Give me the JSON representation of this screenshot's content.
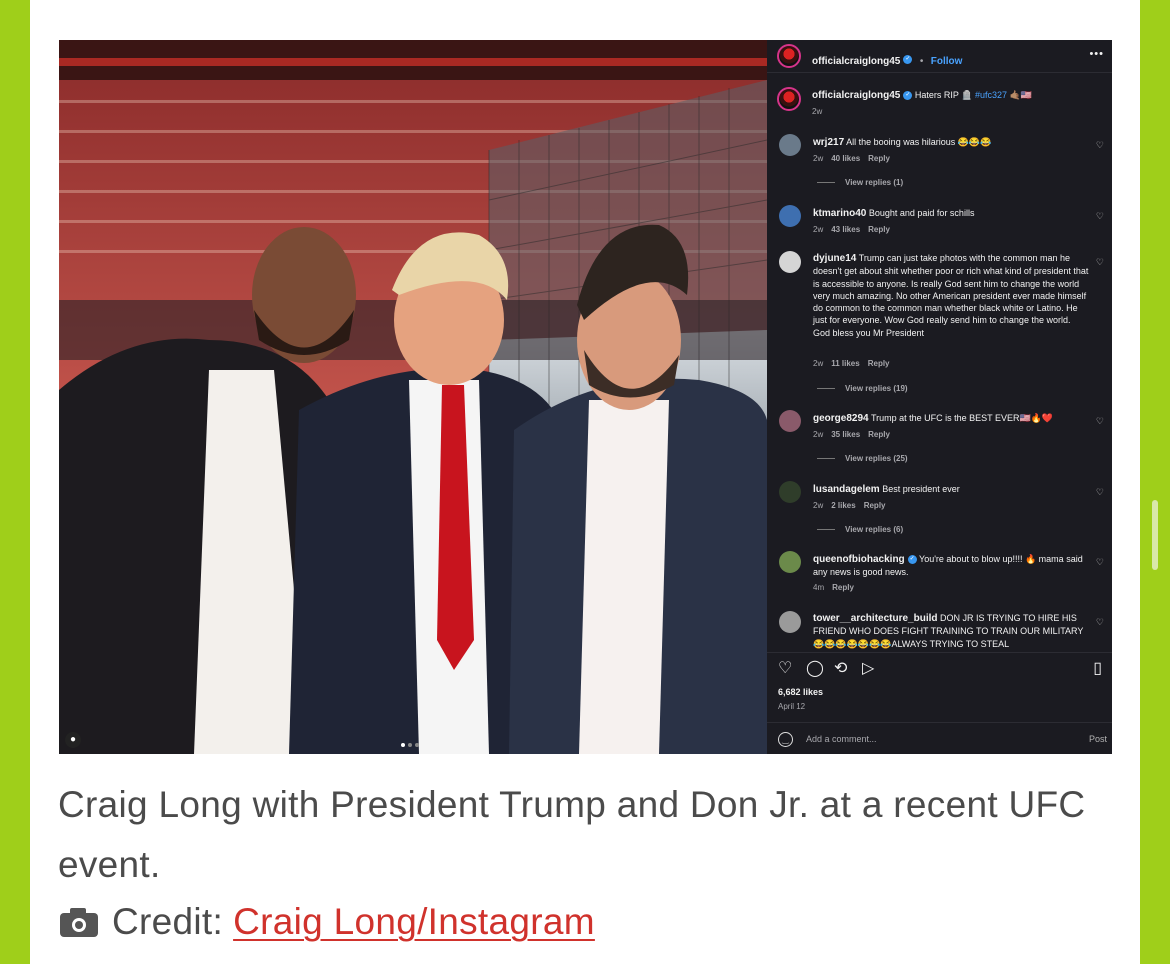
{
  "colors": {
    "side_accent": "#9fcf1a",
    "link": "#d0322c",
    "caption_text": "#4b4b4b",
    "ig_panel_bg": "#1b1b21",
    "ig_link_blue": "#4aa3ff"
  },
  "post": {
    "username": "officialcraiglong45",
    "follow_label": "Follow",
    "more_icon": "more-horizontal-icon",
    "caption_user": "officialcraiglong45",
    "caption_text": "Haters RIP 🪦",
    "caption_hashtag": "#ufc327",
    "caption_emojis": "🤙🏽🇺🇸",
    "caption_age": "2w",
    "likes": "6,682 likes",
    "date": "April 12",
    "add_comment_placeholder": "Add a comment...",
    "post_label": "Post",
    "carousel_dots": 3,
    "carousel_active": 1
  },
  "comments": [
    {
      "user": "wrj217",
      "verified": false,
      "text": "All the booing was hilarious 😂😂😂",
      "age": "2w",
      "likes": "40 likes",
      "reply": "Reply",
      "view_replies": "View replies (1)"
    },
    {
      "user": "ktmarino40",
      "verified": false,
      "text": "Bought and paid for schills",
      "age": "2w",
      "likes": "43 likes",
      "reply": "Reply",
      "view_replies": ""
    },
    {
      "user": "dyjune14",
      "verified": false,
      "text": "Trump can just take photos with the common man he doesn't get about shit whether poor or rich what kind of president that is accessible to anyone. Is really God sent him to change the world very much amazing. No other American president ever made himself do common to the common man whether black white or Latino. He just for everyone. Wow God really send him to change the world. God bless you Mr President",
      "age": "2w",
      "likes": "11 likes",
      "reply": "Reply",
      "view_replies": "View replies (19)"
    },
    {
      "user": "george8294",
      "verified": false,
      "text": "Trump at the UFC is the BEST EVER🇺🇸🔥❤️",
      "age": "2w",
      "likes": "35 likes",
      "reply": "Reply",
      "view_replies": "View replies (25)"
    },
    {
      "user": "lusandagelem",
      "verified": false,
      "text": "Best president ever",
      "age": "2w",
      "likes": "2 likes",
      "reply": "Reply",
      "view_replies": "View replies (6)"
    },
    {
      "user": "queenofbiohacking",
      "verified": true,
      "text": "You're about to blow up!!!! 🔥 mama said any news is good news.",
      "age": "4m",
      "likes": "",
      "reply": "Reply",
      "view_replies": ""
    },
    {
      "user": "tower__architecture_build",
      "verified": false,
      "text": "DON JR IS TRYING TO HIRE HIS FRIEND WHO DOES FIGHT TRAINING TO TRAIN OUR MILITARY 😂😂😂😂😂😂😂ALWAYS TRYING TO STEAL",
      "age": "",
      "likes": "",
      "reply": "",
      "view_replies": ""
    }
  ],
  "icons": {
    "heart": "heart-icon",
    "comment": "comment-icon",
    "repost": "repost-icon",
    "share": "share-icon",
    "bookmark": "bookmark-icon",
    "emoji": "emoji-icon",
    "camera": "camera-icon",
    "user_tag": "user-tag-icon"
  },
  "article": {
    "caption": "Craig Long with President Trump and Don Jr. at a recent UFC event.",
    "credit_label": "Credit:",
    "credit_link": "Craig Long/Instagram"
  }
}
